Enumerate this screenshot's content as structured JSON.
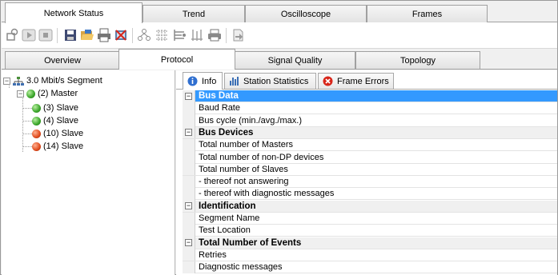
{
  "top_tabs": [
    {
      "label": "Network Status",
      "active": true
    },
    {
      "label": "Trend",
      "active": false
    },
    {
      "label": "Oscilloscope",
      "active": false
    },
    {
      "label": "Frames",
      "active": false
    }
  ],
  "toolbar_icons": [
    "connect-icon",
    "play-icon",
    "stop-icon",
    "save-icon",
    "open-folder-icon",
    "print-preview-icon",
    "delete-icon",
    "network-scan-icon",
    "topology-icon",
    "signal-icon",
    "bus-icon",
    "printer-icon",
    "export-icon"
  ],
  "sub_tabs": [
    {
      "label": "Overview",
      "active": false
    },
    {
      "label": "Protocol",
      "active": true
    },
    {
      "label": "Signal Quality",
      "active": false
    },
    {
      "label": "Topology",
      "active": false
    }
  ],
  "tree": {
    "root": {
      "label": "3.0 Mbit/s Segment",
      "expander": "−"
    },
    "master": {
      "label": "(2) Master",
      "expander": "−",
      "status": "green"
    },
    "slaves": [
      {
        "label": "(3) Slave",
        "status": "green"
      },
      {
        "label": "(4) Slave",
        "status": "green"
      },
      {
        "label": "(10) Slave",
        "status": "red"
      },
      {
        "label": "(14) Slave",
        "status": "red"
      }
    ]
  },
  "panel_tabs": [
    {
      "label": "Info",
      "active": true,
      "icon": "info-icon"
    },
    {
      "label": "Station Statistics",
      "active": false,
      "icon": "bar-chart-icon"
    },
    {
      "label": "Frame Errors",
      "active": false,
      "icon": "error-icon"
    }
  ],
  "property_grid": [
    {
      "type": "category",
      "label": "Bus Data",
      "selected": true
    },
    {
      "type": "item",
      "label": "Baud Rate"
    },
    {
      "type": "item",
      "label": "Bus cycle (min./avg./max.)"
    },
    {
      "type": "category",
      "label": "Bus Devices"
    },
    {
      "type": "item",
      "label": "Total number of Masters"
    },
    {
      "type": "item",
      "label": "Total number of non-DP devices"
    },
    {
      "type": "item",
      "label": "Total number of Slaves"
    },
    {
      "type": "item",
      "label": "- thereof not answering"
    },
    {
      "type": "item",
      "label": "- thereof with diagnostic messages"
    },
    {
      "type": "category",
      "label": "Identification"
    },
    {
      "type": "item",
      "label": "Segment Name"
    },
    {
      "type": "item",
      "label": "Test Location"
    },
    {
      "type": "category",
      "label": "Total Number of Events"
    },
    {
      "type": "item",
      "label": "Retries"
    },
    {
      "type": "item",
      "label": "Diagnostic messages"
    }
  ],
  "colors": {
    "selection": "#3399ff",
    "status_green": "#3aa52a",
    "status_red": "#e04a1c"
  }
}
